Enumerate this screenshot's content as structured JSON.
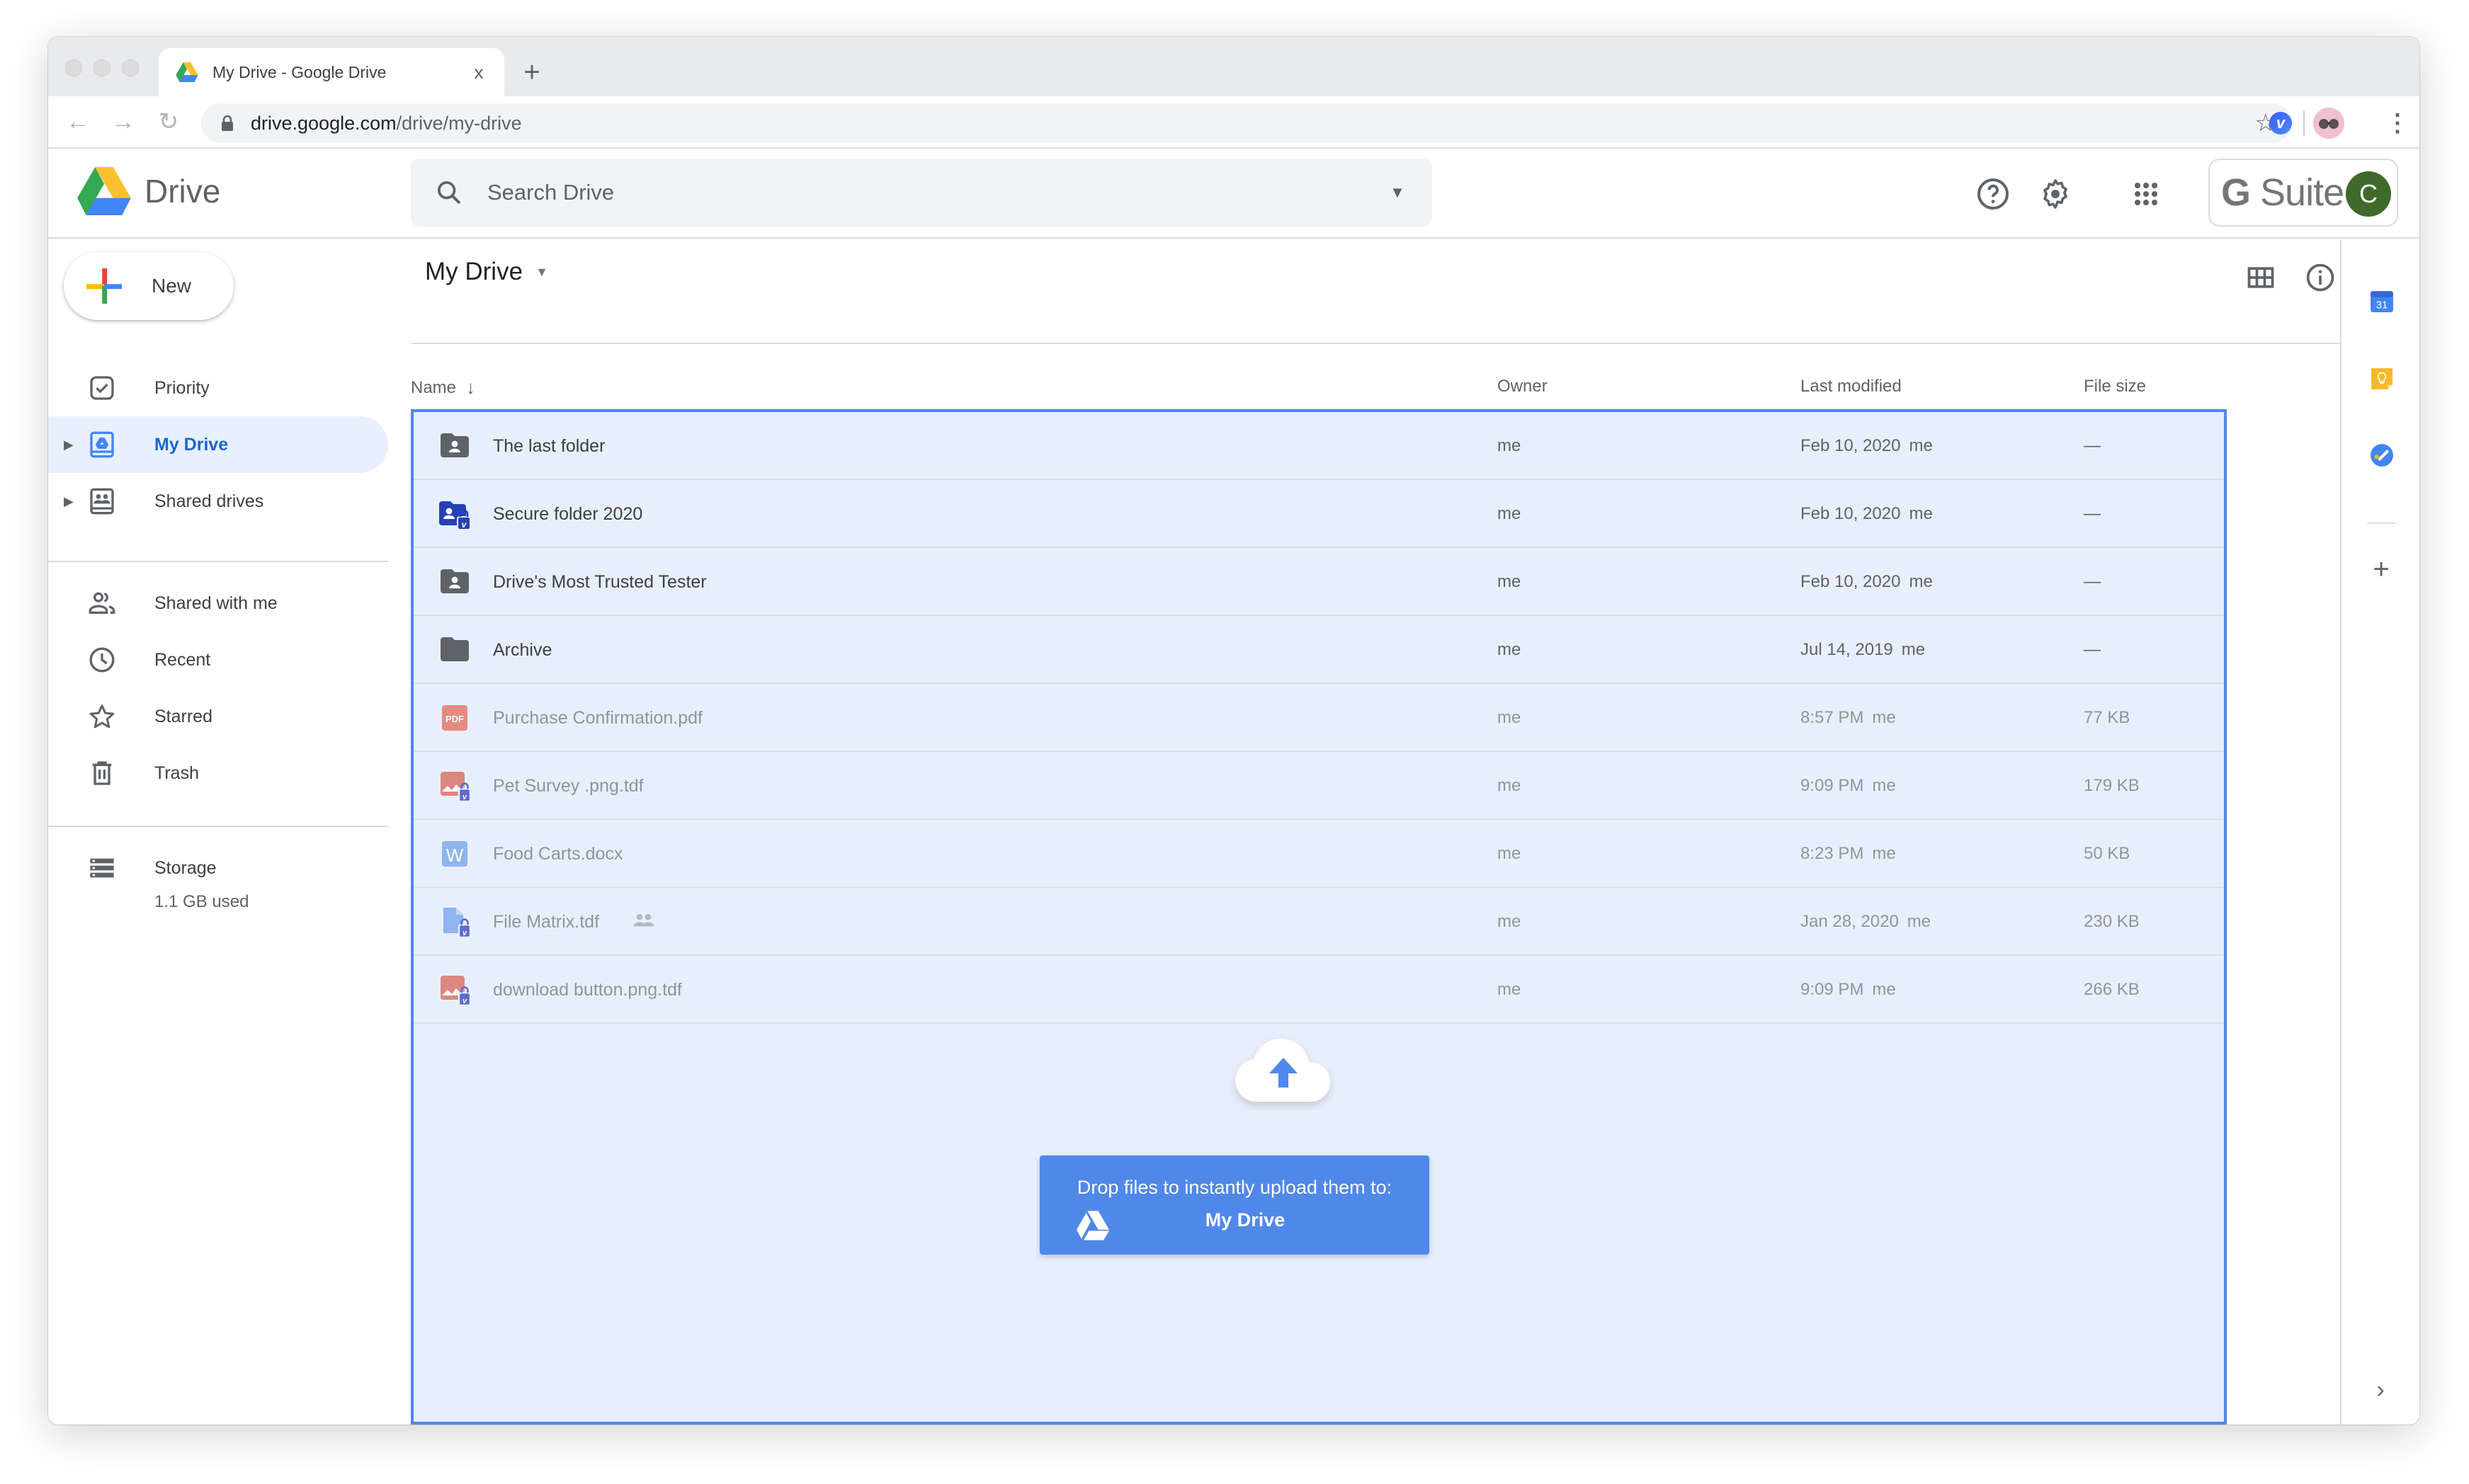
{
  "browser": {
    "tab_title": "My Drive - Google Drive",
    "tab_close": "x",
    "new_tab": "+",
    "url_host": "drive.google.com",
    "url_path": "/drive/my-drive",
    "extension_v_label": "v",
    "menu_glyph": "⋮"
  },
  "header": {
    "app_name": "Drive",
    "search_placeholder": "Search Drive",
    "gsuite_g": "G",
    "gsuite_suite": "Suite",
    "avatar_initial": "C"
  },
  "sidebar": {
    "new_label": "New",
    "items": [
      {
        "label": "Priority",
        "icon": "priority-icon",
        "active": false,
        "expandable": false
      },
      {
        "label": "My Drive",
        "icon": "my-drive-icon",
        "active": true,
        "expandable": true
      },
      {
        "label": "Shared drives",
        "icon": "shared-drives-icon",
        "active": false,
        "expandable": true
      },
      {
        "label": "Shared with me",
        "icon": "shared-with-me-icon",
        "active": false,
        "expandable": false
      },
      {
        "label": "Recent",
        "icon": "clock-icon",
        "active": false,
        "expandable": false
      },
      {
        "label": "Starred",
        "icon": "star-icon",
        "active": false,
        "expandable": false
      },
      {
        "label": "Trash",
        "icon": "trash-icon",
        "active": false,
        "expandable": false
      }
    ],
    "storage_label": "Storage",
    "storage_used": "1.1 GB used"
  },
  "main": {
    "breadcrumb": "My Drive",
    "columns": {
      "name": "Name",
      "owner": "Owner",
      "last_modified": "Last modified",
      "file_size": "File size"
    },
    "sort_indicator": "↓",
    "files": [
      {
        "name": "The last folder",
        "type": "shared-folder",
        "owner": "me",
        "modified": "Feb 10, 2020",
        "modified_by": "me",
        "size": "—",
        "dim": false,
        "shared": false
      },
      {
        "name": "Secure folder 2020",
        "type": "secure-folder",
        "owner": "me",
        "modified": "Feb 10, 2020",
        "modified_by": "me",
        "size": "—",
        "dim": false,
        "shared": false
      },
      {
        "name": "Drive's Most Trusted Tester",
        "type": "shared-folder",
        "owner": "me",
        "modified": "Feb 10, 2020",
        "modified_by": "me",
        "size": "—",
        "dim": false,
        "shared": false
      },
      {
        "name": "Archive",
        "type": "folder",
        "owner": "me",
        "modified": "Jul 14, 2019",
        "modified_by": "me",
        "size": "—",
        "dim": false,
        "shared": false
      },
      {
        "name": "Purchase Confirmation.pdf",
        "type": "pdf",
        "owner": "me",
        "modified": "8:57 PM",
        "modified_by": "me",
        "size": "77 KB",
        "dim": true,
        "shared": false
      },
      {
        "name": "Pet Survey .png.tdf",
        "type": "image-locked",
        "owner": "me",
        "modified": "9:09 PM",
        "modified_by": "me",
        "size": "179 KB",
        "dim": true,
        "shared": false
      },
      {
        "name": "Food Carts.docx",
        "type": "word",
        "owner": "me",
        "modified": "8:23 PM",
        "modified_by": "me",
        "size": "50 KB",
        "dim": true,
        "shared": false
      },
      {
        "name": "File Matrix.tdf",
        "type": "doc-locked",
        "owner": "me",
        "modified": "Jan 28, 2020",
        "modified_by": "me",
        "size": "230 KB",
        "dim": true,
        "shared": true
      },
      {
        "name": "download button.png.tdf",
        "type": "image-locked",
        "owner": "me",
        "modified": "9:09 PM",
        "modified_by": "me",
        "size": "266 KB",
        "dim": true,
        "shared": false
      }
    ],
    "drop_zone": {
      "message": "Drop files to instantly upload them to:",
      "destination": "My Drive"
    }
  },
  "side_panel": {
    "calendar_day": "31",
    "expand_glyph": "›",
    "add_glyph": "+"
  },
  "colors": {
    "accent": "#1a73e8",
    "drop_border": "#4f87ec",
    "drop_fill": "#e8effc",
    "banner": "#5088ea",
    "active_nav_bg": "#e8f0fe",
    "avatar": "#3f6a2a"
  }
}
